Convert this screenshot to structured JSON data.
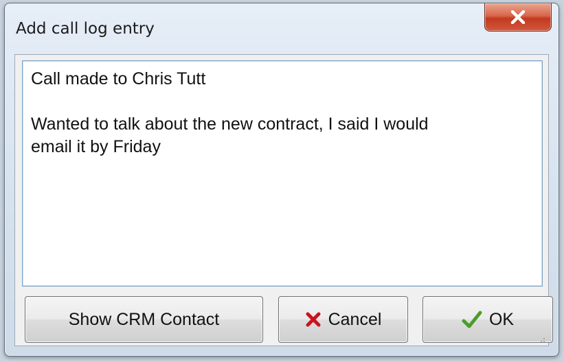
{
  "window": {
    "title": "Add call log entry",
    "close_icon": "close-icon"
  },
  "note": {
    "line1": "Call made to Chris Tutt",
    "line2": "Wanted to talk about the new contract, I said I would",
    "line3": "email it by Friday"
  },
  "buttons": {
    "show_crm_label": "Show CRM Contact",
    "cancel_label": "Cancel",
    "cancel_icon": "red-x-icon",
    "ok_label": "OK",
    "ok_icon": "green-check-icon"
  },
  "colors": {
    "close_button": "#c23a1f",
    "cancel_icon": "#c8141e",
    "ok_icon": "#4a9d2a"
  }
}
